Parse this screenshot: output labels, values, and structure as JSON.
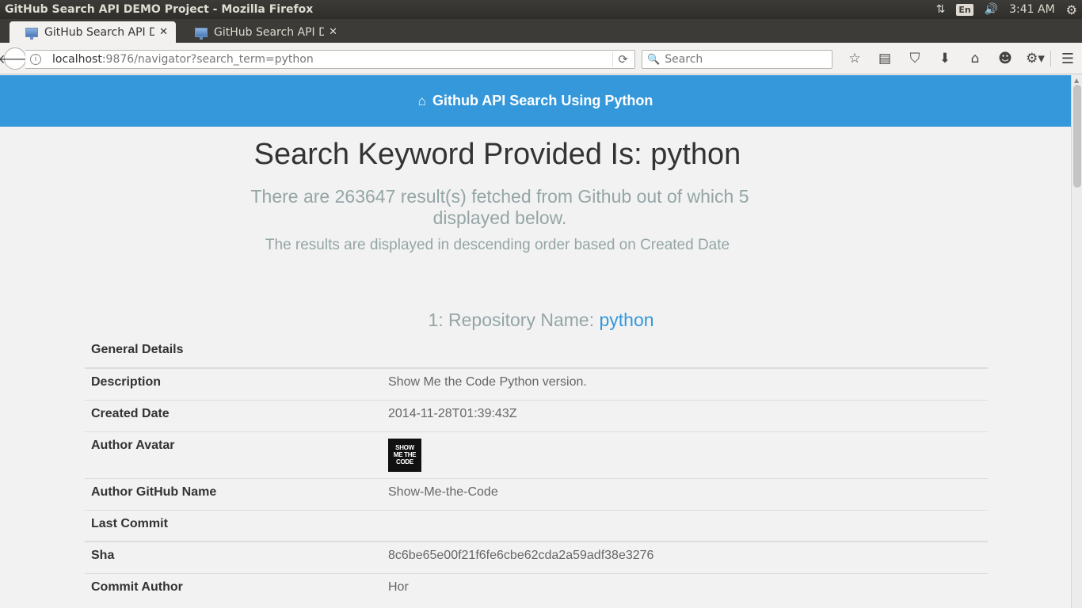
{
  "window": {
    "title": "GitHub Search API DEMO Project - Mozilla Firefox"
  },
  "tray": {
    "lang": "En",
    "time": "3:41 AM"
  },
  "tabs": [
    {
      "label": "GitHub Search API D...",
      "active": true
    },
    {
      "label": "GitHub Search API D...",
      "active": false
    }
  ],
  "nav": {
    "url_host": "localhost",
    "url_path": ":9876/navigator?search_term=python",
    "search_placeholder": "Search"
  },
  "header": {
    "title": "Github API Search Using Python"
  },
  "main": {
    "headline": "Search Keyword Provided Is: python",
    "summary": "There are 263647 result(s) fetched from Github out of which 5 displayed below.",
    "sort_note": "The results are displayed in descending order based on Created Date"
  },
  "repo": {
    "label_prefix": "1: Repository Name:",
    "name": "python",
    "rows": [
      {
        "key": "General Details",
        "value": ""
      },
      {
        "key": "Description",
        "value": "Show Me the Code Python version."
      },
      {
        "key": "Created Date",
        "value": "2014-11-28T01:39:43Z"
      },
      {
        "key": "Author Avatar",
        "value": ""
      },
      {
        "key": "Author GitHub Name",
        "value": "Show-Me-the-Code"
      },
      {
        "key": "Last Commit",
        "value": ""
      },
      {
        "key": "Sha",
        "value": "8c6be65e00f21f6fe6cbe62cda2a59adf38e3276"
      },
      {
        "key": "Commit Author",
        "value": "Hor"
      }
    ],
    "avatar_text": [
      "SHOW",
      "ME THE",
      "CODE"
    ]
  },
  "colors": {
    "header_bg": "#3498db",
    "muted": "#95a5a6",
    "link": "#3498db"
  }
}
